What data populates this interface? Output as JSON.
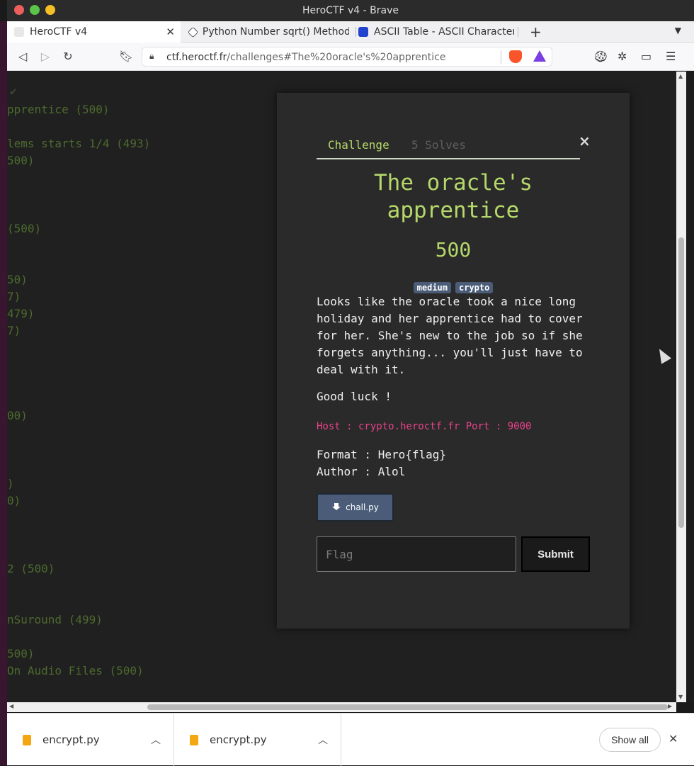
{
  "window": {
    "title": "HeroCTF v4 - Brave"
  },
  "tabs": [
    {
      "label": "HeroCTF v4",
      "active": true
    },
    {
      "label": "Python Number sqrt() Method"
    },
    {
      "label": "ASCII Table - ASCII Character"
    }
  ],
  "address": {
    "url_host": "ctf.heroctf.fr",
    "url_path": "/challenges#The%20oracle's%20apprentice"
  },
  "background_list": [
    "pprentice (500)",
    "lems starts 1/4 (493)",
    "500)",
    "(500)",
    "50)",
    "7)",
    "479)",
    "7)",
    "00)",
    ")",
    "0)",
    "2 (500)",
    "nSuround (499)",
    "500)",
    " On Audio Files (500)"
  ],
  "modal": {
    "tab_challenge": "Challenge",
    "tab_solves": "5 Solves",
    "close": "×",
    "title_line1": "The oracle's",
    "title_line2": "apprentice",
    "value": "500",
    "tags": [
      "medium",
      "crypto"
    ],
    "description": [
      "Looks like the oracle took a nice long",
      "holiday and her apprentice had to cover",
      "for her. She's new to the job so if she",
      "forgets anything... you'll just have to",
      "deal with it."
    ],
    "good_luck": "Good luck !",
    "host": "Host : crypto.heroctf.fr Port : 9000",
    "format": "Format : Hero{flag}",
    "author": "Author : Alol",
    "file_button": "chall.py",
    "flag_placeholder": "Flag",
    "submit": "Submit"
  },
  "downloads": {
    "items": [
      "encrypt.py",
      "encrypt.py"
    ],
    "show_all": "Show all"
  }
}
